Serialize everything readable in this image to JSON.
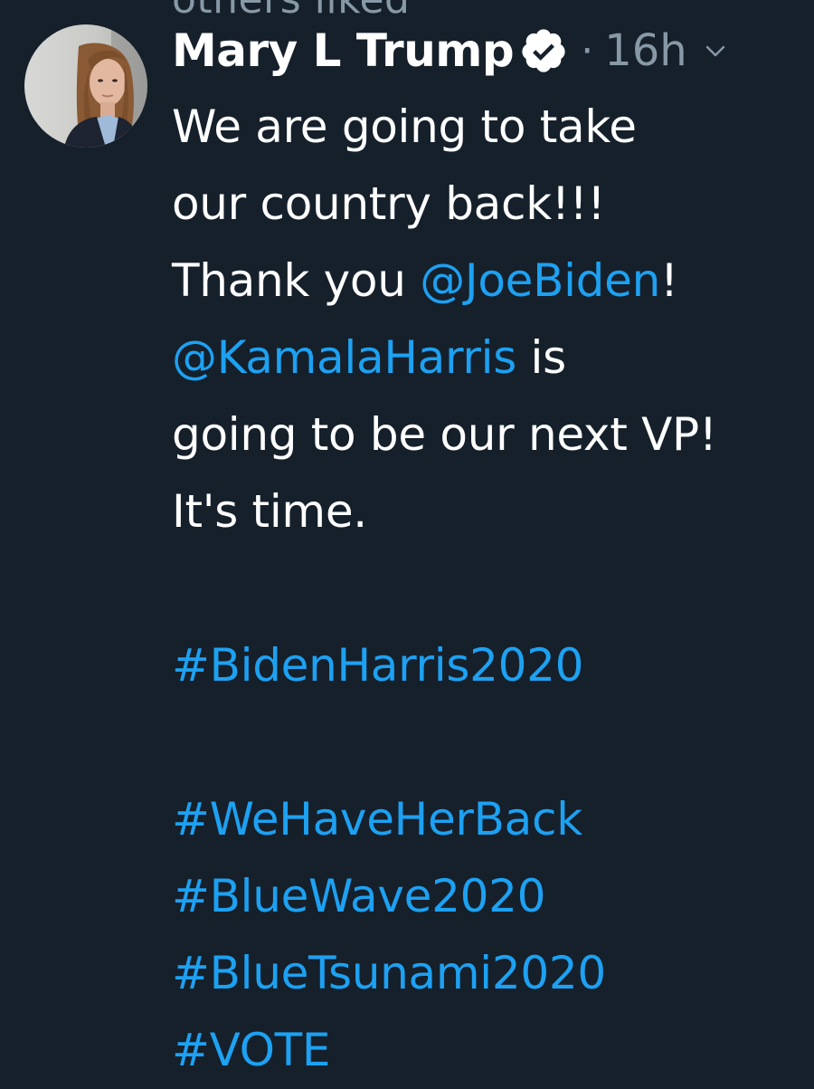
{
  "cutoff_header": "others liked",
  "tweet": {
    "author_name": "Mary L Trump",
    "dot": "·",
    "time": "16h",
    "icons": {
      "verified": "verified-badge-icon",
      "menu": "chevron-down-icon"
    },
    "body": {
      "line1": "We are going to take",
      "line2": "our country back!!!",
      "line3_pre": "Thank you ",
      "line3_mention": "@JoeBiden",
      "line3_post": "!",
      "line4_mention": "@KamalaHarris",
      "line4_post": " is",
      "line5": "going to be our next VP!",
      "line6": "It's time.",
      "hashtags": {
        "h1": "#BidenHarris2020",
        "h2": "#WeHaveHerBack",
        "h3": "#BlueWave2020",
        "h4": "#BlueTsunami2020",
        "h5": "#VOTE"
      }
    }
  },
  "colors": {
    "background": "#15202b",
    "text": "#ffffff",
    "secondary_text": "#8899a6",
    "link": "#1da1f2"
  }
}
